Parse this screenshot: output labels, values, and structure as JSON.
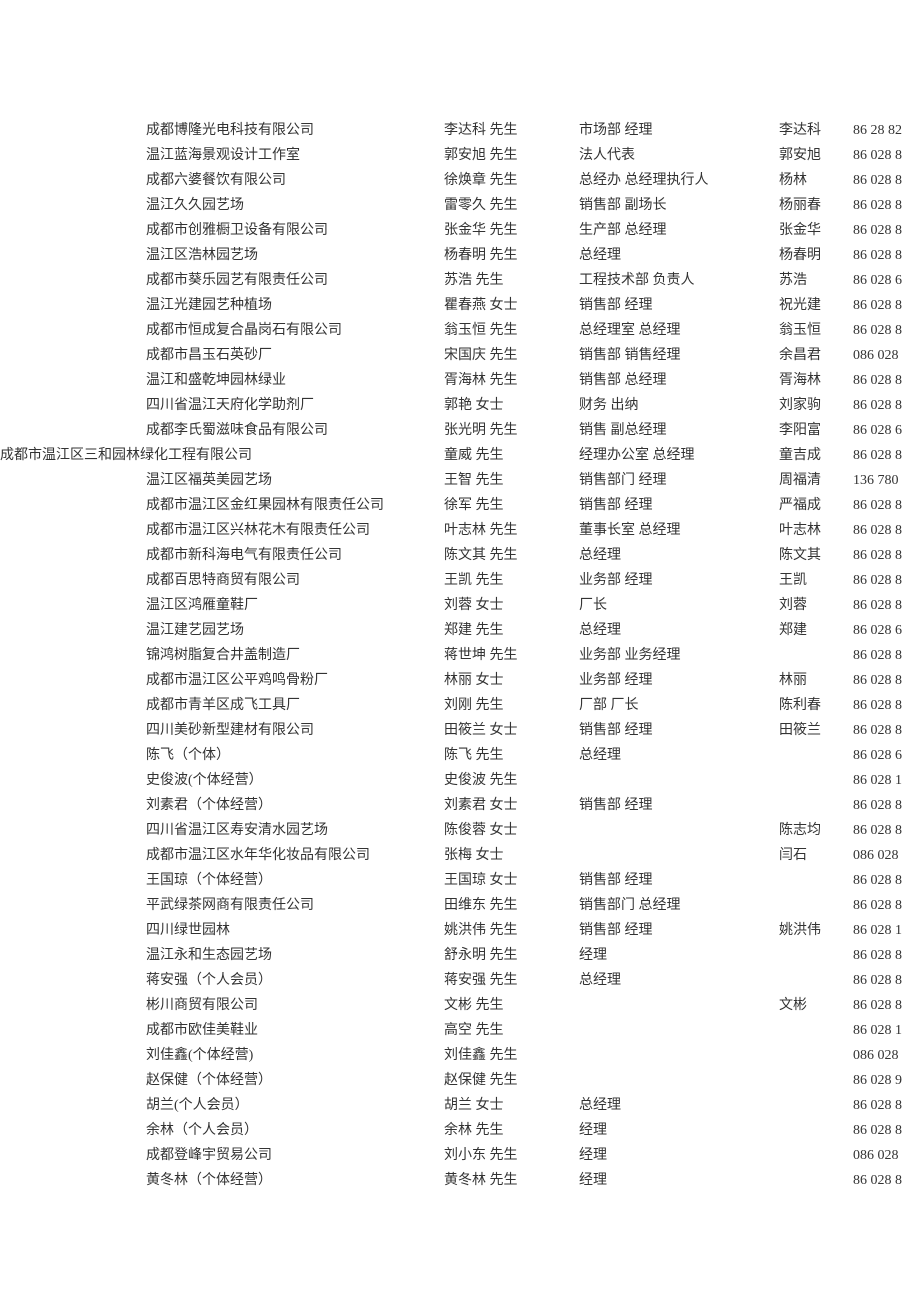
{
  "rows": [
    {
      "company": "成都博隆光电科技有限公司",
      "contact": "李达科 先生",
      "dept": "市场部 经理",
      "leader": "李达科",
      "phone": "86 28 82"
    },
    {
      "company": "温江蓝海景观设计工作室",
      "contact": "郭安旭 先生",
      "dept": "法人代表",
      "leader": "郭安旭",
      "phone": "86 028 8"
    },
    {
      "company": "成都六婆餐饮有限公司",
      "contact": "徐焕章 先生",
      "dept": "总经办 总经理执行人",
      "leader": "杨林",
      "phone": "86 028 8"
    },
    {
      "company": "温江久久园艺场",
      "contact": "雷零久 先生",
      "dept": "销售部 副场长",
      "leader": "杨丽春",
      "phone": "86 028 8"
    },
    {
      "company": "成都市创雅橱卫设备有限公司",
      "contact": "张金华 先生",
      "dept": "生产部 总经理",
      "leader": "张金华",
      "phone": "86 028 8"
    },
    {
      "company": "温江区浩林园艺场",
      "contact": "杨春明 先生",
      "dept": "总经理",
      "leader": "杨春明",
      "phone": "86 028 8"
    },
    {
      "company": "成都市葵乐园艺有限责任公司",
      "contact": "苏浩 先生",
      "dept": "工程技术部 负责人",
      "leader": "苏浩",
      "phone": "86 028 6"
    },
    {
      "company": "温江光建园艺种植场",
      "contact": "瞿春燕 女士",
      "dept": "销售部 经理",
      "leader": "祝光建",
      "phone": "86 028 8"
    },
    {
      "company": "成都市恒成复合晶岗石有限公司",
      "contact": "翁玉恒 先生",
      "dept": "总经理室 总经理",
      "leader": "翁玉恒",
      "phone": "86 028 8"
    },
    {
      "company": "成都市昌玉石英砂厂",
      "contact": "宋国庆 先生",
      "dept": "销售部 销售经理",
      "leader": "余昌君",
      "phone": "086 028"
    },
    {
      "company": "温江和盛乾坤园林绿业",
      "contact": "胥海林 先生",
      "dept": "销售部 总经理",
      "leader": "胥海林",
      "phone": "86 028 8"
    },
    {
      "company": "四川省温江天府化学助剂厂",
      "contact": "郭艳 女士",
      "dept": "财务 出纳",
      "leader": "刘家驹",
      "phone": "86 028 8"
    },
    {
      "company": "成都李氏蜀滋味食品有限公司",
      "contact": "张光明 先生",
      "dept": "销售 副总经理",
      "leader": "李阳富",
      "phone": "86 028 6"
    },
    {
      "company": "成都市温江区三和园林绿化工程有限公司",
      "contact": "童威  先生",
      "dept": "经理办公室 总经理",
      "leader": "童吉成",
      "phone": "86 028 8",
      "wrap": true
    },
    {
      "company": "温江区福英美园艺场",
      "contact": "王智 先生",
      "dept": "销售部门 经理",
      "leader": "周福清",
      "phone": "136 780"
    },
    {
      "company": "成都市温江区金红果园林有限责任公司",
      "contact": "徐军 先生",
      "dept": "销售部 经理",
      "leader": "严福成",
      "phone": "86 028 8"
    },
    {
      "company": "成都市温江区兴林花木有限责任公司",
      "contact": "叶志林 先生",
      "dept": "董事长室 总经理",
      "leader": "叶志林",
      "phone": "86 028 8"
    },
    {
      "company": "成都市新科海电气有限责任公司",
      "contact": "陈文其 先生",
      "dept": "总经理",
      "leader": "陈文其",
      "phone": "86 028 8"
    },
    {
      "company": "成都百思特商贸有限公司",
      "contact": "王凯 先生",
      "dept": "业务部 经理",
      "leader": "王凯",
      "phone": "86 028 8"
    },
    {
      "company": "温江区鸿雁童鞋厂",
      "contact": "刘蓉 女士",
      "dept": "厂长",
      "leader": "刘蓉",
      "phone": "86 028 8"
    },
    {
      "company": "温江建艺园艺场",
      "contact": "郑建 先生",
      "dept": "总经理",
      "leader": "郑建",
      "phone": "86 028 6"
    },
    {
      "company": "锦鸿树脂复合井盖制造厂",
      "contact": "蒋世坤 先生",
      "dept": "业务部 业务经理",
      "leader": "",
      "phone": "86 028 8"
    },
    {
      "company": "成都市温江区公平鸡鸣骨粉厂",
      "contact": "林丽 女士",
      "dept": "业务部 经理",
      "leader": "林丽",
      "phone": "86 028 8"
    },
    {
      "company": "成都市青羊区成飞工具厂",
      "contact": "刘刚 先生",
      "dept": "厂部 厂长",
      "leader": "陈利春",
      "phone": "86 028 8"
    },
    {
      "company": "四川美砂新型建材有限公司",
      "contact": "田筱兰 女士",
      "dept": "销售部 经理",
      "leader": "田筱兰",
      "phone": "86 028 8"
    },
    {
      "company": "陈飞（个体）",
      "contact": "陈飞 先生",
      "dept": "总经理",
      "leader": "",
      "phone": "86 028 6"
    },
    {
      "company": "史俊波(个体经营）",
      "contact": "史俊波 先生",
      "dept": "",
      "leader": "",
      "phone": "86 028 1"
    },
    {
      "company": "刘素君（个体经营）",
      "contact": "刘素君 女士",
      "dept": "销售部 经理",
      "leader": "",
      "phone": "86 028 8"
    },
    {
      "company": "四川省温江区寿安清水园艺场",
      "contact": "陈俊蓉 女士",
      "dept": "",
      "leader": "陈志均",
      "phone": "86 028 8"
    },
    {
      "company": "成都市温江区水年华化妆品有限公司",
      "contact": "张梅 女士",
      "dept": "",
      "leader": "闫石",
      "phone": "086 028"
    },
    {
      "company": "王国琼（个体经营）",
      "contact": "王国琼 女士",
      "dept": "销售部 经理",
      "leader": "",
      "phone": "86 028 8"
    },
    {
      "company": "平武绿茶网商有限责任公司",
      "contact": "田维东 先生",
      "dept": "销售部门 总经理",
      "leader": "",
      "phone": "86 028 8"
    },
    {
      "company": "四川绿世园林",
      "contact": "姚洪伟 先生",
      "dept": "销售部 经理",
      "leader": "姚洪伟",
      "phone": "86 028 1"
    },
    {
      "company": "温江永和生态园艺场",
      "contact": "舒永明 先生",
      "dept": "经理",
      "leader": "",
      "phone": "86 028 8"
    },
    {
      "company": "蒋安强（个人会员）",
      "contact": "蒋安强 先生",
      "dept": "总经理",
      "leader": "",
      "phone": "86 028 8"
    },
    {
      "company": "彬川商贸有限公司",
      "contact": "文彬 先生",
      "dept": "",
      "leader": "文彬",
      "phone": "86 028 8"
    },
    {
      "company": "成都市欧佳美鞋业",
      "contact": "高空 先生",
      "dept": "",
      "leader": "",
      "phone": "86 028 1"
    },
    {
      "company": "刘佳鑫(个体经营)",
      "contact": "刘佳鑫 先生",
      "dept": "",
      "leader": "",
      "phone": "086 028"
    },
    {
      "company": "赵保健（个体经营）",
      "contact": "赵保健 先生",
      "dept": "",
      "leader": "",
      "phone": "86 028 9"
    },
    {
      "company": "胡兰(个人会员）",
      "contact": "胡兰 女士",
      "dept": "总经理",
      "leader": "",
      "phone": "86 028 8"
    },
    {
      "company": "余林（个人会员）",
      "contact": "余林 先生",
      "dept": "经理",
      "leader": "",
      "phone": "86 028 8"
    },
    {
      "company": "成都登峰宇贸易公司",
      "contact": "刘小东 先生",
      "dept": "经理",
      "leader": "",
      "phone": "086 028"
    },
    {
      "company": "黄冬林（个体经营）",
      "contact": "黄冬林 先生",
      "dept": "经理",
      "leader": "",
      "phone": "86 028 8"
    }
  ]
}
